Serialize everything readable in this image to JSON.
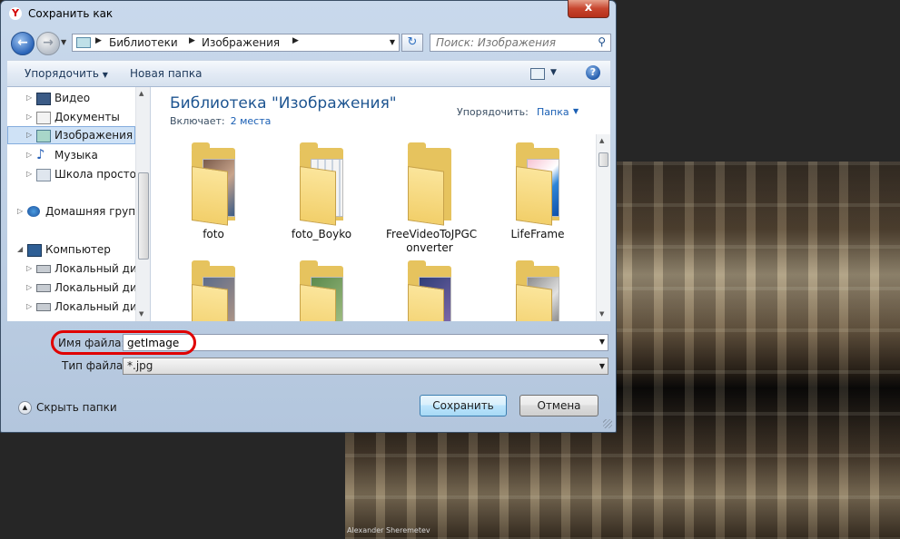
{
  "window": {
    "title": "Сохранить как",
    "app_icon": "Y",
    "close": "x"
  },
  "address_bar": {
    "crumbs": [
      "Библиотеки",
      "Изображения"
    ],
    "search_placeholder": "Поиск: Изображения"
  },
  "toolbar": {
    "organize": "Упорядочить",
    "new_folder": "Новая папка",
    "help": "?"
  },
  "nav": {
    "items": [
      {
        "label": "Видео",
        "icon": "video-icon"
      },
      {
        "label": "Документы",
        "icon": "documents-icon"
      },
      {
        "label": "Изображения",
        "icon": "pictures-icon",
        "selected": true
      },
      {
        "label": "Музыка",
        "icon": "music-icon"
      },
      {
        "label": "Школа просто",
        "icon": "library-icon"
      },
      {
        "label": "Домашняя группа",
        "icon": "homegroup-icon"
      },
      {
        "label": "Компьютер",
        "icon": "computer-icon"
      },
      {
        "label": "Локальный диск",
        "icon": "disk-icon"
      },
      {
        "label": "Локальный диск",
        "icon": "disk-icon"
      },
      {
        "label": "Локальный диск",
        "icon": "disk-icon"
      }
    ]
  },
  "library": {
    "title": "Библиотека \"Изображения\"",
    "includes_label": "Включает:",
    "includes_link": "2 места",
    "arrange_label": "Упорядочить:",
    "arrange_value": "Папка"
  },
  "folders": [
    {
      "name": "foto"
    },
    {
      "name": "foto_Boyko"
    },
    {
      "name": "FreeVideoToJPGC onverter"
    },
    {
      "name": "LifeFrame"
    },
    {
      "name": ""
    },
    {
      "name": ""
    },
    {
      "name": ""
    },
    {
      "name": ""
    }
  ],
  "form": {
    "filename_label": "Имя файла:",
    "filename_value": "getImage",
    "filetype_label": "Тип файла:",
    "filetype_value": "*.jpg"
  },
  "footer": {
    "hide_folders": "Скрыть папки",
    "save": "Сохранить",
    "cancel": "Отмена"
  },
  "photo": {
    "credit": "Alexander Sheremetev"
  },
  "colors": {
    "accent": "#1e5591",
    "highlight": "#e00000"
  }
}
